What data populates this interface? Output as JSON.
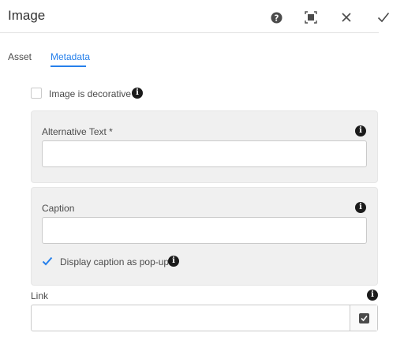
{
  "dialog": {
    "title": "Image",
    "icons": {
      "help": "help-icon",
      "fullscreen": "fullscreen-icon",
      "close": "close-icon",
      "done": "checkmark-icon"
    }
  },
  "tabs": [
    {
      "label": "Asset",
      "active": false
    },
    {
      "label": "Metadata",
      "active": true
    }
  ],
  "decorative": {
    "label": "Image is decorative",
    "checked": false
  },
  "alt_text": {
    "label": "Alternative Text *",
    "value": ""
  },
  "caption": {
    "label": "Caption",
    "value": "",
    "popup_label": "Display caption as pop-up",
    "popup_checked": true
  },
  "link": {
    "label": "Link",
    "value": ""
  },
  "info_glyph": "i",
  "colors": {
    "accent": "#2680eb",
    "panel_bg": "#f0f0f0",
    "info_icon": "#1b1b1b"
  }
}
